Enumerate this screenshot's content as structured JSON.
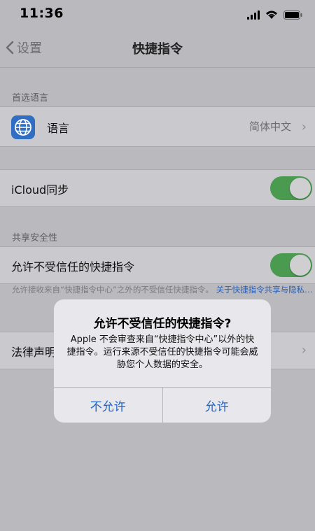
{
  "status_bar": {
    "time": "11:36"
  },
  "nav": {
    "back_label": "设置",
    "title": "快捷指令"
  },
  "sections": {
    "preferred_language_header": "首选语言",
    "language_label": "语言",
    "language_value": "简体中文",
    "icloud_label": "iCloud同步",
    "icloud_on": true,
    "shared_security_header": "共享安全性",
    "allow_untrusted_label": "允许不受信任的快捷指令",
    "allow_untrusted_on": true,
    "footer_text": "允许接收来自“快捷指令中心”之外的不受信任快捷指令。",
    "footer_link": "关于快捷指令共享与隐私…",
    "legal_label": "法律声明"
  },
  "alert": {
    "title": "允许不受信任的快捷指令?",
    "message": "Apple 不会审查来自“快捷指令中心”以外的快捷指令。运行来源不受信任的快捷指令可能会威胁您个人数据的安全。",
    "cancel_label": "不允许",
    "allow_label": "允许"
  },
  "colors": {
    "accent": "#1e63c9",
    "toggle_on": "#4a9a50",
    "icon_bg": "#2f6ec2"
  }
}
